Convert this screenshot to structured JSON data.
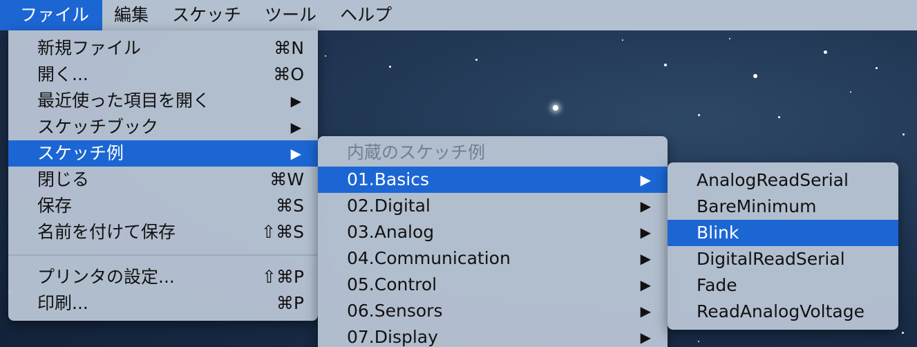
{
  "menubar": {
    "items": [
      {
        "label": "ファイル"
      },
      {
        "label": "編集"
      },
      {
        "label": "スケッチ"
      },
      {
        "label": "ツール"
      },
      {
        "label": "ヘルプ"
      }
    ]
  },
  "file_menu": {
    "items": [
      {
        "label": "新規ファイル",
        "shortcut": "⌘N"
      },
      {
        "label": "開く...",
        "shortcut": "⌘O"
      },
      {
        "label": "最近使った項目を開く",
        "arrow": "▶"
      },
      {
        "label": "スケッチブック",
        "arrow": "▶"
      },
      {
        "label": "スケッチ例",
        "arrow": "▶"
      },
      {
        "label": "閉じる",
        "shortcut": "⌘W"
      },
      {
        "label": "保存",
        "shortcut": "⌘S"
      },
      {
        "label": "名前を付けて保存",
        "shortcut": "⇧⌘S"
      },
      {
        "label": "プリンタの設定...",
        "shortcut": "⇧⌘P"
      },
      {
        "label": "印刷...",
        "shortcut": "⌘P"
      }
    ]
  },
  "examples_menu": {
    "header": "内蔵のスケッチ例",
    "items": [
      {
        "label": "01.Basics",
        "arrow": "▶"
      },
      {
        "label": "02.Digital",
        "arrow": "▶"
      },
      {
        "label": "03.Analog",
        "arrow": "▶"
      },
      {
        "label": "04.Communication",
        "arrow": "▶"
      },
      {
        "label": "05.Control",
        "arrow": "▶"
      },
      {
        "label": "06.Sensors",
        "arrow": "▶"
      },
      {
        "label": "07.Display",
        "arrow": "▶"
      }
    ]
  },
  "basics_menu": {
    "items": [
      {
        "label": "AnalogReadSerial"
      },
      {
        "label": "BareMinimum"
      },
      {
        "label": "Blink"
      },
      {
        "label": "DigitalReadSerial"
      },
      {
        "label": "Fade"
      },
      {
        "label": "ReadAnalogVoltage"
      }
    ]
  },
  "colors": {
    "accent": "#1c66d4",
    "menu_bg": "#b7c4d3",
    "menubar_bg": "#b3c0cf",
    "desktop": "#1e3350"
  }
}
